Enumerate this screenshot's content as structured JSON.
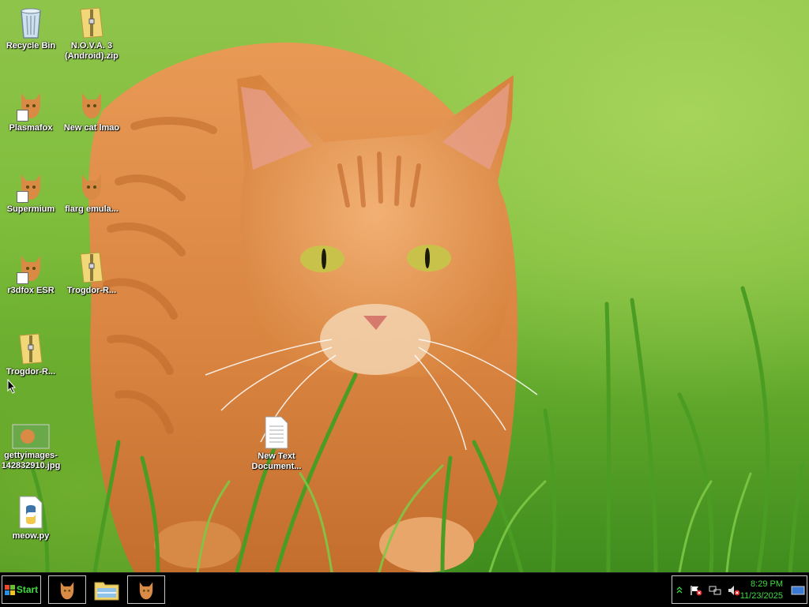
{
  "desktop": {
    "icons": [
      {
        "label": "Recycle Bin",
        "icon": "recycle-bin-icon"
      },
      {
        "label": "N.O.V.A. 3 (Android).zip",
        "icon": "zip-folder-icon"
      },
      {
        "label": "Plasmafox",
        "icon": "cat-icon"
      },
      {
        "label": "New cat lmao",
        "icon": "cat-icon"
      },
      {
        "label": "Supermium",
        "icon": "cat-icon"
      },
      {
        "label": "flarg emula...",
        "icon": "cat-icon"
      },
      {
        "label": "r3dfox ESR",
        "icon": "cat-icon"
      },
      {
        "label": "Trogdor-R...",
        "icon": "zip-folder-icon"
      },
      {
        "label": "Trogdor-R...",
        "icon": "zip-folder-icon"
      },
      {
        "label": "gettyimages-142832910.jpg",
        "icon": "image-thumbnail-icon"
      },
      {
        "label": "meow.py",
        "icon": "python-file-icon"
      },
      {
        "label": "New Text Document...",
        "icon": "text-document-icon"
      }
    ]
  },
  "taskbar": {
    "start_label": "Start",
    "tasks": [
      {
        "icon": "cat-icon"
      },
      {
        "icon": "file-explorer-icon"
      },
      {
        "icon": "cat-icon"
      }
    ],
    "tray": {
      "icons": [
        "show-hidden-icons-icon",
        "action-center-flag-icon",
        "network-icon",
        "volume-muted-icon",
        "show-desktop-icon"
      ],
      "time": "8:29 PM",
      "date": "11/23/2025"
    }
  },
  "colors": {
    "taskbar_bg": "#000000",
    "clock_text": "#3fdc3f",
    "button_border": "#c7c7c7"
  }
}
